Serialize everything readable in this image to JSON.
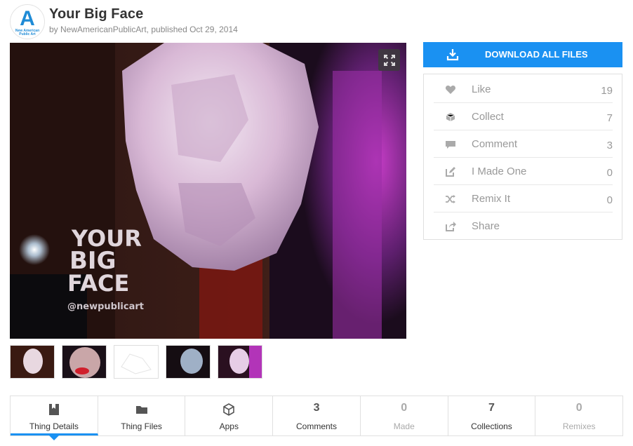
{
  "header": {
    "title": "Your Big Face",
    "byline": "by NewAmericanPublicArt, published Oct 29, 2014",
    "avatar_letter": "A",
    "avatar_text": "New American Public Art"
  },
  "image": {
    "overlay_line1": "YOUR",
    "overlay_line2": "BIG",
    "overlay_line3": "FACE",
    "overlay_handle": "@newpublicart"
  },
  "download": {
    "label": "DOWNLOAD ALL FILES"
  },
  "actions": [
    {
      "icon": "heart-icon",
      "label": "Like",
      "count": "19"
    },
    {
      "icon": "collect-icon",
      "label": "Collect",
      "count": "7"
    },
    {
      "icon": "comment-icon",
      "label": "Comment",
      "count": "3"
    },
    {
      "icon": "edit-icon",
      "label": "I Made One",
      "count": "0"
    },
    {
      "icon": "shuffle-icon",
      "label": "Remix It",
      "count": "0"
    },
    {
      "icon": "share-icon",
      "label": "Share",
      "count": ""
    }
  ],
  "tabs": [
    {
      "label": "Thing Details",
      "icon": "book-icon",
      "active": true
    },
    {
      "label": "Thing Files",
      "icon": "folder-icon"
    },
    {
      "label": "Apps",
      "icon": "cube-icon"
    },
    {
      "label": "Comments",
      "count": "3"
    },
    {
      "label": "Made",
      "count": "0"
    },
    {
      "label": "Collections",
      "count": "7"
    },
    {
      "label": "Remixes",
      "count": "0"
    }
  ],
  "colors": {
    "accent": "#1a91f2",
    "muted_text": "#999999"
  }
}
